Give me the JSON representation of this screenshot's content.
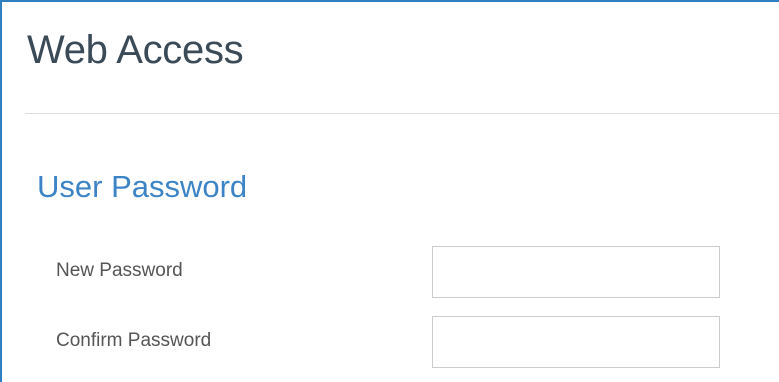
{
  "page": {
    "title": "Web Access"
  },
  "section": {
    "title": "User Password"
  },
  "form": {
    "new_password": {
      "label": "New Password",
      "value": "",
      "placeholder": ""
    },
    "confirm_password": {
      "label": "Confirm Password",
      "value": "",
      "placeholder": ""
    }
  },
  "colors": {
    "accent": "#2f7fc1",
    "section_title": "#3d84c6",
    "page_title": "#3a4a57",
    "label": "#555555"
  }
}
